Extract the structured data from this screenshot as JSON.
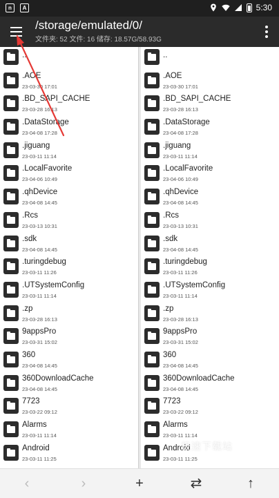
{
  "status_bar": {
    "time": "5:30",
    "left_icons": [
      "nfc-icon",
      "a-box-icon"
    ],
    "right_icons": [
      "location-icon",
      "wifi-icon",
      "signal-icon",
      "battery-icon"
    ]
  },
  "app_bar": {
    "title": "/storage/emulated/0/",
    "subtitle": "文件夹: 52  文件: 16  储存: 18.57G/58.93G"
  },
  "files": [
    {
      "name": "..",
      "date": ""
    },
    {
      "name": ".AOE",
      "date": "23-03-30 17:01"
    },
    {
      "name": ".BD_SAPI_CACHE",
      "date": "23-03-28 16:13"
    },
    {
      "name": ".DataStorage",
      "date": "23-04-08 17:28"
    },
    {
      "name": ".jiguang",
      "date": "23-03-11 11:14"
    },
    {
      "name": ".LocalFavorite",
      "date": "23-04-06 10:49"
    },
    {
      "name": ".qhDevice",
      "date": "23-04-08 14:45"
    },
    {
      "name": ".Rcs",
      "date": "23-03-13 10:31"
    },
    {
      "name": ".sdk",
      "date": "23-04-08 14:45"
    },
    {
      "name": ".turingdebug",
      "date": "23-03-11 11:26"
    },
    {
      "name": ".UTSystemConfig",
      "date": "23-03-11 11:14"
    },
    {
      "name": ".zp",
      "date": "23-03-28 16:13"
    },
    {
      "name": "9appsPro",
      "date": "23-03-31 15:02"
    },
    {
      "name": "360",
      "date": "23-04-08 14:45"
    },
    {
      "name": "360DownloadCache",
      "date": "23-04-08 14:45"
    },
    {
      "name": "7723",
      "date": "23-03-22 09:12"
    },
    {
      "name": "Alarms",
      "date": "23-03-11 11:14"
    },
    {
      "name": "Android",
      "date": "23-03-11 11:25"
    }
  ],
  "bottom_bar": {
    "buttons": [
      {
        "name": "back-arrow-icon",
        "glyph": "‹",
        "enabled": false
      },
      {
        "name": "forward-arrow-icon",
        "glyph": "›",
        "enabled": false
      },
      {
        "name": "add-icon",
        "glyph": "+",
        "enabled": true
      },
      {
        "name": "swap-icon",
        "glyph": "⇄",
        "enabled": true
      },
      {
        "name": "up-arrow-icon",
        "glyph": "↑",
        "enabled": true
      }
    ]
  },
  "watermark": "极速下载站",
  "colors": {
    "app_bar": "#2b2b2b",
    "status_bar": "#1f1f1f",
    "folder_icon": "#2c2c2c",
    "annotation_arrow": "#e53935"
  }
}
